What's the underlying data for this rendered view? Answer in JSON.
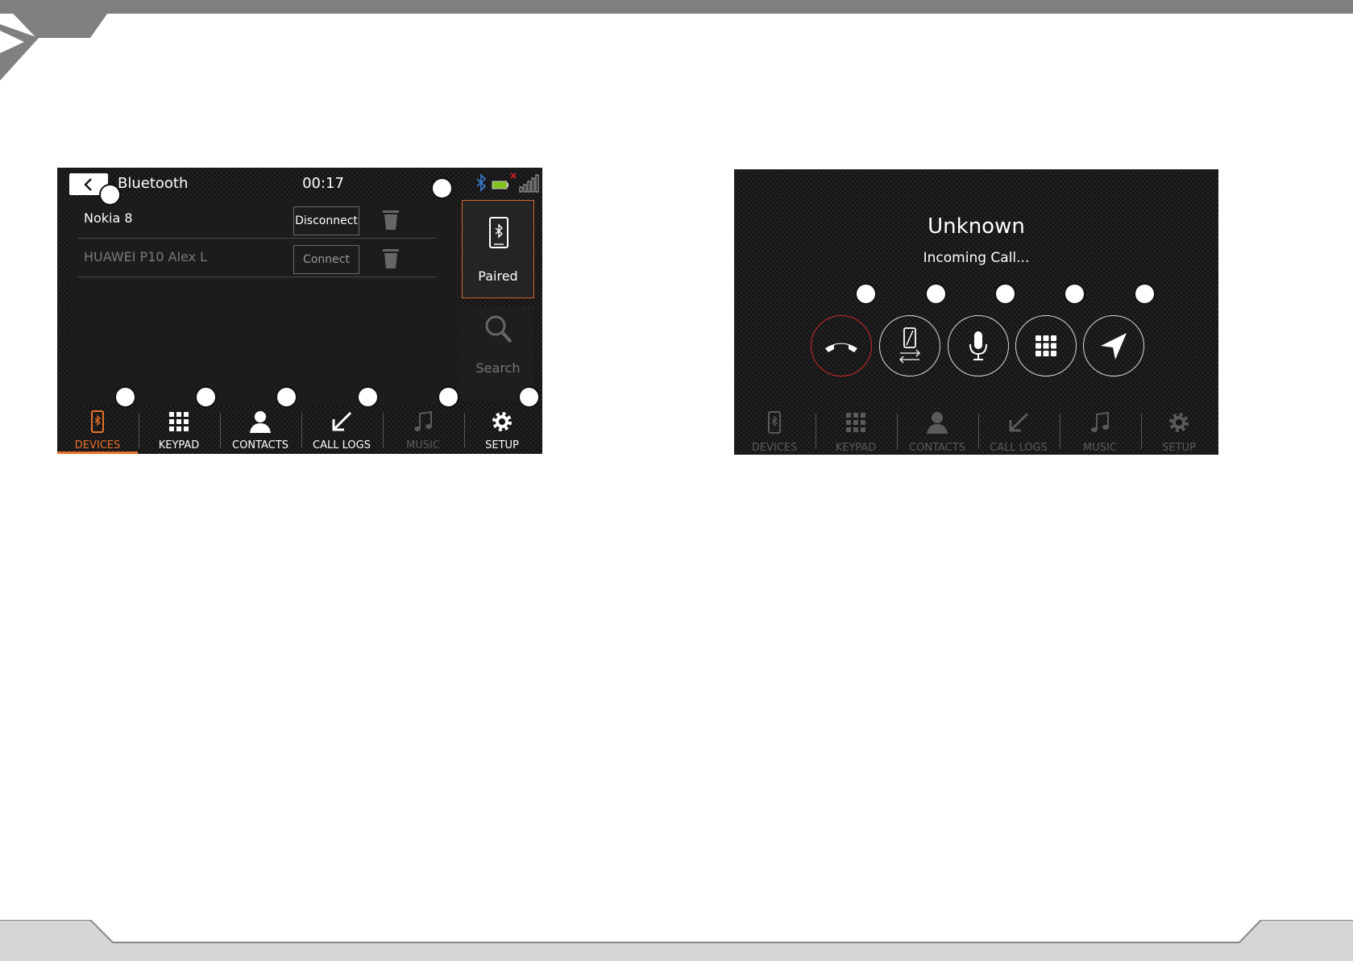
{
  "colors": {
    "accent": "#e8702a",
    "screen_bg": "#141414",
    "text_primary": "#ffffff",
    "text_dim": "#7a7a7a",
    "end_call_red": "#d02828",
    "bluetooth_blue": "#3a7bd5",
    "battery_green": "#7fc31c",
    "page_chrome_gray": "#808080"
  },
  "bluetooth_screen": {
    "header": {
      "back_icon": "chevron-left-icon",
      "title": "Bluetooth",
      "time": "00:17",
      "status_icons": [
        "bluetooth-icon",
        "battery-icon",
        "no-signal-icon",
        "signal-bars-icon"
      ]
    },
    "devices": [
      {
        "name": "Nokia 8",
        "button_label": "Disconnect",
        "connected": true,
        "delete_icon": "trash-icon"
      },
      {
        "name": "HUAWEI P10 Alex L",
        "button_label": "Connect",
        "connected": false,
        "delete_icon": "trash-icon"
      }
    ],
    "side_tabs": {
      "paired_label": "Paired",
      "paired_icon": "bluetooth-phone-icon",
      "search_label": "Search",
      "search_icon": "search-icon"
    },
    "nav": {
      "devices": "DEVICES",
      "keypad": "KEYPAD",
      "contacts": "CONTACTS",
      "call_logs": "CALL LOGS",
      "music": "MUSIC",
      "setup": "SETUP",
      "active": "DEVICES"
    }
  },
  "incoming_call_screen": {
    "caller": "Unknown",
    "status": "Incoming Call...",
    "actions": [
      "end-call-icon",
      "transfer-to-phone-icon",
      "microphone-icon",
      "keypad-icon",
      "navigation-icon"
    ],
    "nav": {
      "devices": "DEVICES",
      "keypad": "KEYPAD",
      "contacts": "CONTACTS",
      "call_logs": "CALL LOGS",
      "music": "MUSIC",
      "setup": "SETUP"
    }
  }
}
